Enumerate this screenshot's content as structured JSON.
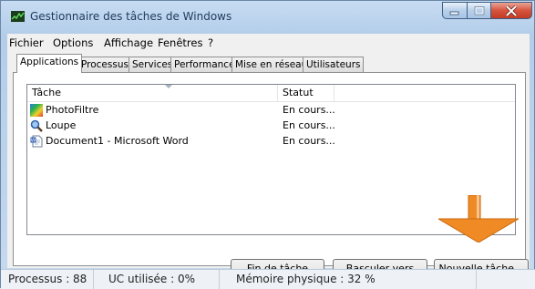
{
  "window": {
    "title": "Gestionnaire des tâches de Windows",
    "icon": "task-manager-icon"
  },
  "menu": {
    "items": [
      "Fichier",
      "Options",
      "Affichage",
      "Fenêtres",
      "?"
    ]
  },
  "tabs": [
    {
      "label": "Applications",
      "active": true
    },
    {
      "label": "Processus",
      "active": false
    },
    {
      "label": "Services",
      "active": false
    },
    {
      "label": "Performance",
      "active": false
    },
    {
      "label": "Mise en réseau",
      "active": false
    },
    {
      "label": "Utilisateurs",
      "active": false
    }
  ],
  "list": {
    "columns": {
      "task": "Tâche",
      "status": "Statut"
    },
    "rows": [
      {
        "task": "PhotoFiltre",
        "status": "En cours...",
        "icon": "photofiltre-icon"
      },
      {
        "task": "Loupe",
        "status": "En cours...",
        "icon": "magnifier-icon"
      },
      {
        "task": "Document1 - Microsoft Word",
        "status": "En cours...",
        "icon": "word-document-icon"
      }
    ]
  },
  "buttons": {
    "end_task": "Fin de tâche",
    "switch_to": "Basculer vers",
    "new_task": "Nouvelle tâche..."
  },
  "status_bar": {
    "processes": "Processus : 88",
    "cpu": "UC utilisée : 0%",
    "memory": "Mémoire physique : 32 %"
  },
  "colors": {
    "title_text": "#1e395b",
    "close_button": "#c94630",
    "arrow": "#f08a24"
  }
}
